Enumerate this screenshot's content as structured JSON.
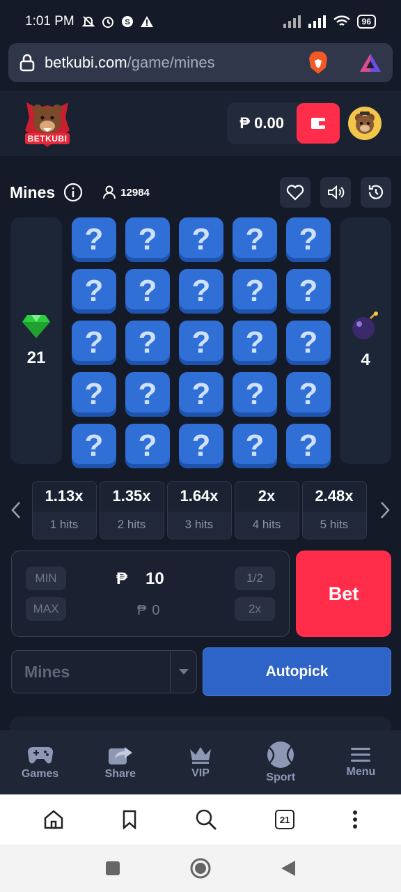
{
  "status": {
    "time": "1:01 PM",
    "battery": "96"
  },
  "browser": {
    "url_host": "betkubi.com",
    "url_path": "/game/mines",
    "tab_count": "21"
  },
  "header": {
    "logo_text": "BETKUBI",
    "balance": "₱ 0.00"
  },
  "game": {
    "title": "Mines",
    "players": "12984",
    "gems": "21",
    "mines": "4"
  },
  "grid": {
    "tile_symbol": "?",
    "rows": 5,
    "cols": 5
  },
  "multipliers": [
    {
      "value": "1.13x",
      "hits": "1 hits"
    },
    {
      "value": "1.35x",
      "hits": "2 hits"
    },
    {
      "value": "1.64x",
      "hits": "3 hits"
    },
    {
      "value": "2x",
      "hits": "4 hits"
    },
    {
      "value": "2.48x",
      "hits": "5 hits"
    }
  ],
  "bet": {
    "min_label": "MIN",
    "max_label": "MAX",
    "half_label": "1/2",
    "double_label": "2x",
    "currency": "₱",
    "amount": "10",
    "profit": "0",
    "bet_label": "Bet"
  },
  "controls": {
    "mines_select": "Mines",
    "autopick_label": "Autopick"
  },
  "nav": [
    {
      "label": "Games",
      "icon": "gamepad-icon"
    },
    {
      "label": "Share",
      "icon": "share-icon"
    },
    {
      "label": "VIP",
      "icon": "crown-icon"
    },
    {
      "label": "Sport",
      "icon": "tennis-ball-icon"
    },
    {
      "label": "Menu",
      "icon": "menu-icon"
    }
  ],
  "colors": {
    "accent_red": "#ff2d4a",
    "tile_blue": "#2f6fd6",
    "autopick_blue": "#2e63c7",
    "bg": "#141a27"
  }
}
